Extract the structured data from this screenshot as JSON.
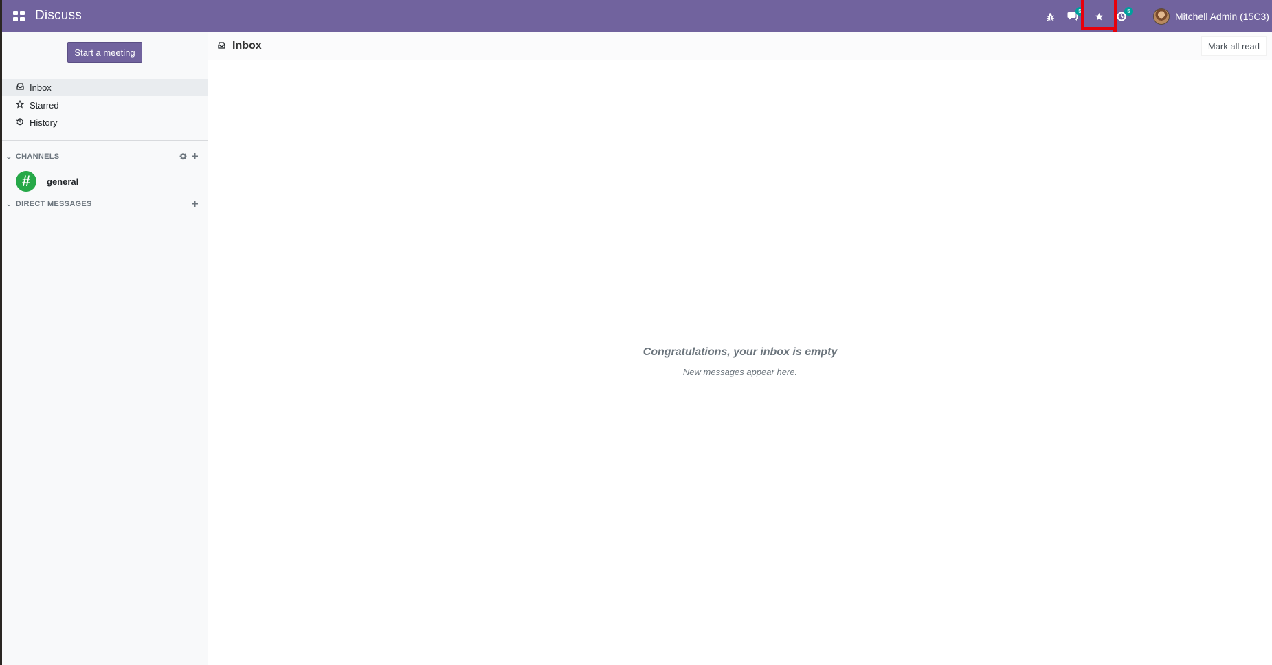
{
  "navbar": {
    "app_title": "Discuss",
    "apps_icon": "grid-icon",
    "systray": [
      {
        "icon": "bug-icon",
        "name": "debug"
      },
      {
        "icon": "comments-icon",
        "name": "messaging",
        "badge": "5"
      },
      {
        "icon": "star-icon",
        "name": "starred"
      },
      {
        "icon": "clock-icon",
        "name": "activities",
        "badge": "5"
      }
    ],
    "user_name": "Mitchell Admin (15C3)",
    "accent": "#71639e",
    "highlight_color": "#e8000b"
  },
  "sidebar": {
    "start_meeting": "Start a meeting",
    "mailboxes": [
      {
        "label": "Inbox",
        "icon": "inbox-icon",
        "active": true
      },
      {
        "label": "Starred",
        "icon": "star-outline-icon",
        "active": false
      },
      {
        "label": "History",
        "icon": "history-icon",
        "active": false
      }
    ],
    "channels_label": "CHANNELS",
    "channels": [
      {
        "name": "general",
        "avatar_glyph": "#",
        "avatar_color": "#26a848"
      }
    ],
    "direct_messages_label": "DIRECT MESSAGES"
  },
  "thread": {
    "title": "Inbox",
    "mark_all_read": "Mark all read",
    "empty_title": "Congratulations, your inbox is empty",
    "empty_subtitle": "New messages appear here."
  }
}
